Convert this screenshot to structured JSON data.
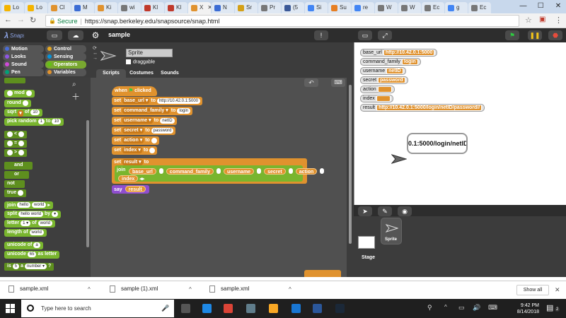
{
  "browser": {
    "tabs": [
      {
        "label": "Lo",
        "color": "#f4b400"
      },
      {
        "label": "Lo",
        "color": "#f4b400"
      },
      {
        "label": "Cl",
        "color": "#e0922e"
      },
      {
        "label": "M",
        "color": "#3b6cd4"
      },
      {
        "label": "Ki",
        "color": "#e0922e"
      },
      {
        "label": "wi",
        "color": "#777777"
      },
      {
        "label": "Kl",
        "color": "#c0392b"
      },
      {
        "label": "Kl",
        "color": "#c0392b"
      },
      {
        "label": "X",
        "color": "#e0922e"
      },
      {
        "label": "N",
        "color": "#3b6cd4"
      },
      {
        "label": "Sr",
        "color": "#d4a017"
      },
      {
        "label": "Pr",
        "color": "#777777"
      },
      {
        "label": "(5",
        "color": "#3b5998"
      },
      {
        "label": "Si",
        "color": "#4285f4"
      },
      {
        "label": "Su",
        "color": "#e67e22"
      },
      {
        "label": "re",
        "color": "#4285f4"
      },
      {
        "label": "W",
        "color": "#777777"
      },
      {
        "label": "W",
        "color": "#777777"
      },
      {
        "label": "Ec",
        "color": "#777777"
      },
      {
        "label": "g",
        "color": "#4285f4"
      },
      {
        "label": "Ec",
        "color": "#777777"
      }
    ],
    "active_tab": 8,
    "close_glyph": "✕",
    "win_buttons": {
      "minimize": "—",
      "maximize": "☐",
      "close": "✕"
    },
    "secure_label": "Secure",
    "url": "https://snap.berkeley.edu/snapsource/snap.html"
  },
  "snap": {
    "project_name": "sample",
    "categories": [
      {
        "label": "Motion",
        "color": "#4a6cd4"
      },
      {
        "label": "Control",
        "color": "#e6a822"
      },
      {
        "label": "Looks",
        "color": "#8f56e3"
      },
      {
        "label": "Sensing",
        "color": "#0494dc"
      },
      {
        "label": "Sound",
        "color": "#cf4ad9"
      },
      {
        "label": "Operators",
        "color": "#62c213"
      },
      {
        "label": "Pen",
        "color": "#00a178"
      },
      {
        "label": "Variables",
        "color": "#e0922e"
      }
    ],
    "selected_category": "Operators",
    "palette": {
      "mod": "mod",
      "round": "round",
      "sqrt": "sqrt",
      "of": "of",
      "sqrt_val": "10",
      "pick_random": "pick random",
      "to": "to",
      "rand_from": "1",
      "rand_to": "10",
      "and": "and",
      "or": "or",
      "not": "not",
      "true": "true",
      "join": "join",
      "join_a": "hello",
      "join_b": "world",
      "split": "split",
      "split_text": "hello world",
      "by": "by",
      "letter": "letter",
      "letter_idx": "1",
      "letter_of": "of",
      "letter_word": "world",
      "length_of": "length of",
      "length_word": "world",
      "unicode_of": "unicode of",
      "unicode_of_val": "a",
      "unicode": "unicode",
      "unicode_val": "65",
      "as_letter": "as letter",
      "is": "is",
      "is_val": "5",
      "a": "a",
      "number": "number",
      "q": "?"
    },
    "sprite": {
      "name": "Sprite",
      "draggable_label": "draggable",
      "tabs": [
        "Scripts",
        "Costumes",
        "Sounds"
      ],
      "active_tab": "Scripts"
    },
    "script": {
      "hat_when": "when",
      "hat_clicked": "clicked",
      "set": "set",
      "to": "to",
      "assignments": [
        {
          "var": "base_url",
          "value": "http://10.42.0.1:5000"
        },
        {
          "var": "command_family",
          "value": "login"
        },
        {
          "var": "username",
          "value": "netID"
        },
        {
          "var": "secret",
          "value": "password"
        },
        {
          "var": "action",
          "value": ""
        },
        {
          "var": "index",
          "value": ""
        }
      ],
      "result_var": "result",
      "join_label": "join",
      "join_items": [
        "base_url",
        "command_family",
        "username",
        "secret",
        "action"
      ],
      "join_last": "index",
      "say_label": "say",
      "say_var": "result"
    },
    "watchers": [
      {
        "name": "base_url",
        "value": "http://10.42.0.1:5000"
      },
      {
        "name": "command_family",
        "value": "login"
      },
      {
        "name": "username",
        "value": "netID"
      },
      {
        "name": "secret",
        "value": "password"
      },
      {
        "name": "action",
        "value": ""
      },
      {
        "name": "index",
        "value": ""
      },
      {
        "name": "result",
        "value": "http://10.42.0.1:5000/login/netID/password//"
      }
    ],
    "speech_bubble": "0.1:5000/login/netID",
    "corral": {
      "stage_label": "Stage",
      "sprite_label": "Sprite"
    }
  },
  "downloads": {
    "items": [
      "sample.xml",
      "sample (1).xml",
      "sample.xml"
    ],
    "chevron": "^",
    "show_all": "Show all",
    "close": "✕"
  },
  "taskbar": {
    "search_placeholder": "Type here to search",
    "time": "9:42 PM",
    "date": "8/14/2018",
    "notification_count": "2",
    "icons": [
      {
        "name": "task-view",
        "color": "#555555"
      },
      {
        "name": "edge",
        "color": "#1e88e5"
      },
      {
        "name": "chrome",
        "color": "#db4437"
      },
      {
        "name": "store",
        "color": "#607d8b"
      },
      {
        "name": "explorer",
        "color": "#f9a825"
      },
      {
        "name": "mail",
        "color": "#1976d2"
      },
      {
        "name": "word",
        "color": "#2b579a"
      },
      {
        "name": "steam",
        "color": "#1b2838"
      }
    ]
  }
}
